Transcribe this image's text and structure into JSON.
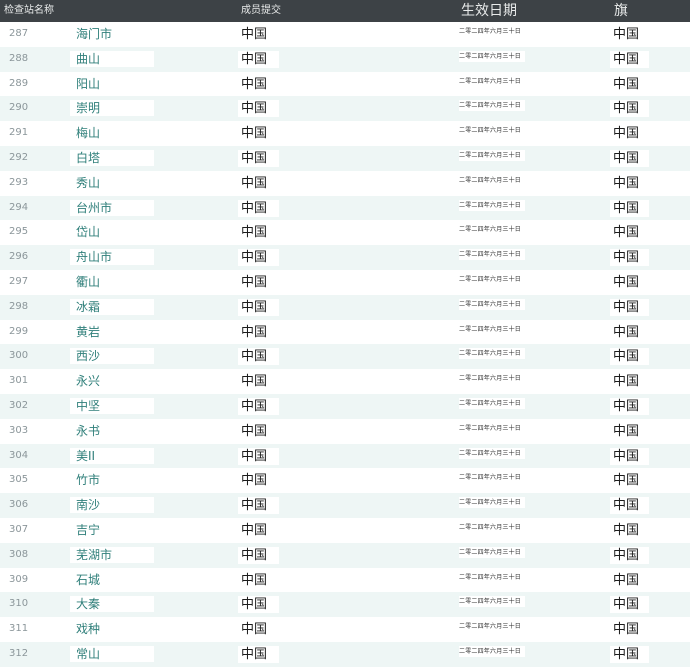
{
  "header": {
    "name": "检查站名称",
    "member": "成员提交",
    "date": "生效日期",
    "flag": "旗"
  },
  "rows": [
    {
      "num": "287",
      "name": "海门市",
      "member": "中国",
      "date": "二零二四年六月三十日",
      "flag": "中国"
    },
    {
      "num": "288",
      "name": "曲山",
      "member": "中国",
      "date": "二零二四年六月三十日",
      "flag": "中国"
    },
    {
      "num": "289",
      "name": "阳山",
      "member": "中国",
      "date": "二零二四年六月三十日",
      "flag": "中国"
    },
    {
      "num": "290",
      "name": "崇明",
      "member": "中国",
      "date": "二零二四年六月三十日",
      "flag": "中国"
    },
    {
      "num": "291",
      "name": "梅山",
      "member": "中国",
      "date": "二零二四年六月三十日",
      "flag": "中国"
    },
    {
      "num": "292",
      "name": "白塔",
      "member": "中国",
      "date": "二零二四年六月三十日",
      "flag": "中国"
    },
    {
      "num": "293",
      "name": "秀山",
      "member": "中国",
      "date": "二零二四年六月三十日",
      "flag": "中国"
    },
    {
      "num": "294",
      "name": "台州市",
      "member": "中国",
      "date": "二零二四年六月三十日",
      "flag": "中国"
    },
    {
      "num": "295",
      "name": "岱山",
      "member": "中国",
      "date": "二零二四年六月三十日",
      "flag": "中国"
    },
    {
      "num": "296",
      "name": "舟山市",
      "member": "中国",
      "date": "二零二四年六月三十日",
      "flag": "中国"
    },
    {
      "num": "297",
      "name": "衢山",
      "member": "中国",
      "date": "二零二四年六月三十日",
      "flag": "中国"
    },
    {
      "num": "298",
      "name": "冰霜",
      "member": "中国",
      "date": "二零二四年六月三十日",
      "flag": "中国"
    },
    {
      "num": "299",
      "name": "黄岩",
      "member": "中国",
      "date": "二零二四年六月三十日",
      "flag": "中国"
    },
    {
      "num": "300",
      "name": "西沙",
      "member": "中国",
      "date": "二零二四年六月三十日",
      "flag": "中国"
    },
    {
      "num": "301",
      "name": "永兴",
      "member": "中国",
      "date": "二零二四年六月三十日",
      "flag": "中国"
    },
    {
      "num": "302",
      "name": "中坚",
      "member": "中国",
      "date": "二零二四年六月三十日",
      "flag": "中国"
    },
    {
      "num": "303",
      "name": "永书",
      "member": "中国",
      "date": "二零二四年六月三十日",
      "flag": "中国"
    },
    {
      "num": "304",
      "name": "美II",
      "member": "中国",
      "date": "二零二四年六月三十日",
      "flag": "中国"
    },
    {
      "num": "305",
      "name": "竹市",
      "member": "中国",
      "date": "二零二四年六月三十日",
      "flag": "中国"
    },
    {
      "num": "306",
      "name": "南沙",
      "member": "中国",
      "date": "二零二四年六月三十日",
      "flag": "中国"
    },
    {
      "num": "307",
      "name": "吉宁",
      "member": "中国",
      "date": "二零二四年六月三十日",
      "flag": "中国"
    },
    {
      "num": "308",
      "name": "芜湖市",
      "member": "中国",
      "date": "二零二四年六月三十日",
      "flag": "中国"
    },
    {
      "num": "309",
      "name": "石城",
      "member": "中国",
      "date": "二零二四年六月三十日",
      "flag": "中国"
    },
    {
      "num": "310",
      "name": "大秦",
      "member": "中国",
      "date": "二零二四年六月三十日",
      "flag": "中国"
    },
    {
      "num": "311",
      "name": "戏种",
      "member": "中国",
      "date": "二零二四年六月三十日",
      "flag": "中国"
    },
    {
      "num": "312",
      "name": "常山",
      "member": "中国",
      "date": "二零二四年六月三十日",
      "flag": "中国"
    }
  ]
}
